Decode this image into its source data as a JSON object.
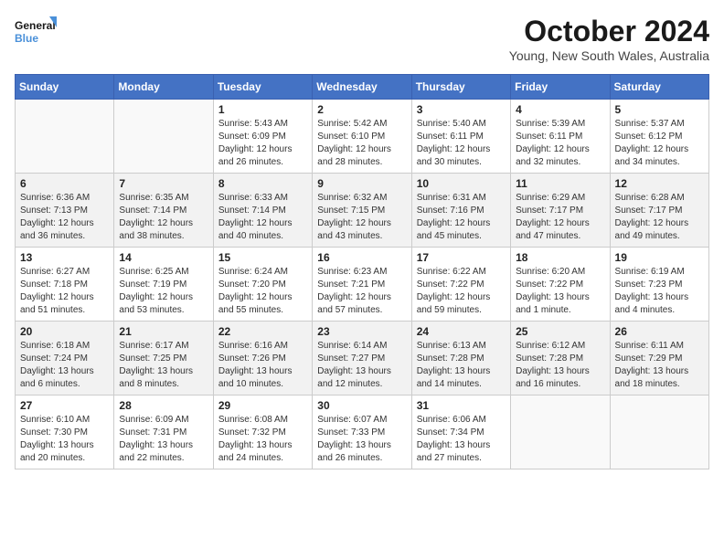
{
  "header": {
    "logo_general": "General",
    "logo_blue": "Blue",
    "month": "October 2024",
    "location": "Young, New South Wales, Australia"
  },
  "days_of_week": [
    "Sunday",
    "Monday",
    "Tuesday",
    "Wednesday",
    "Thursday",
    "Friday",
    "Saturday"
  ],
  "weeks": [
    [
      {
        "day": "",
        "sunrise": "",
        "sunset": "",
        "daylight": ""
      },
      {
        "day": "",
        "sunrise": "",
        "sunset": "",
        "daylight": ""
      },
      {
        "day": "1",
        "sunrise": "Sunrise: 5:43 AM",
        "sunset": "Sunset: 6:09 PM",
        "daylight": "Daylight: 12 hours and 26 minutes."
      },
      {
        "day": "2",
        "sunrise": "Sunrise: 5:42 AM",
        "sunset": "Sunset: 6:10 PM",
        "daylight": "Daylight: 12 hours and 28 minutes."
      },
      {
        "day": "3",
        "sunrise": "Sunrise: 5:40 AM",
        "sunset": "Sunset: 6:11 PM",
        "daylight": "Daylight: 12 hours and 30 minutes."
      },
      {
        "day": "4",
        "sunrise": "Sunrise: 5:39 AM",
        "sunset": "Sunset: 6:11 PM",
        "daylight": "Daylight: 12 hours and 32 minutes."
      },
      {
        "day": "5",
        "sunrise": "Sunrise: 5:37 AM",
        "sunset": "Sunset: 6:12 PM",
        "daylight": "Daylight: 12 hours and 34 minutes."
      }
    ],
    [
      {
        "day": "6",
        "sunrise": "Sunrise: 6:36 AM",
        "sunset": "Sunset: 7:13 PM",
        "daylight": "Daylight: 12 hours and 36 minutes."
      },
      {
        "day": "7",
        "sunrise": "Sunrise: 6:35 AM",
        "sunset": "Sunset: 7:14 PM",
        "daylight": "Daylight: 12 hours and 38 minutes."
      },
      {
        "day": "8",
        "sunrise": "Sunrise: 6:33 AM",
        "sunset": "Sunset: 7:14 PM",
        "daylight": "Daylight: 12 hours and 40 minutes."
      },
      {
        "day": "9",
        "sunrise": "Sunrise: 6:32 AM",
        "sunset": "Sunset: 7:15 PM",
        "daylight": "Daylight: 12 hours and 43 minutes."
      },
      {
        "day": "10",
        "sunrise": "Sunrise: 6:31 AM",
        "sunset": "Sunset: 7:16 PM",
        "daylight": "Daylight: 12 hours and 45 minutes."
      },
      {
        "day": "11",
        "sunrise": "Sunrise: 6:29 AM",
        "sunset": "Sunset: 7:17 PM",
        "daylight": "Daylight: 12 hours and 47 minutes."
      },
      {
        "day": "12",
        "sunrise": "Sunrise: 6:28 AM",
        "sunset": "Sunset: 7:17 PM",
        "daylight": "Daylight: 12 hours and 49 minutes."
      }
    ],
    [
      {
        "day": "13",
        "sunrise": "Sunrise: 6:27 AM",
        "sunset": "Sunset: 7:18 PM",
        "daylight": "Daylight: 12 hours and 51 minutes."
      },
      {
        "day": "14",
        "sunrise": "Sunrise: 6:25 AM",
        "sunset": "Sunset: 7:19 PM",
        "daylight": "Daylight: 12 hours and 53 minutes."
      },
      {
        "day": "15",
        "sunrise": "Sunrise: 6:24 AM",
        "sunset": "Sunset: 7:20 PM",
        "daylight": "Daylight: 12 hours and 55 minutes."
      },
      {
        "day": "16",
        "sunrise": "Sunrise: 6:23 AM",
        "sunset": "Sunset: 7:21 PM",
        "daylight": "Daylight: 12 hours and 57 minutes."
      },
      {
        "day": "17",
        "sunrise": "Sunrise: 6:22 AM",
        "sunset": "Sunset: 7:22 PM",
        "daylight": "Daylight: 12 hours and 59 minutes."
      },
      {
        "day": "18",
        "sunrise": "Sunrise: 6:20 AM",
        "sunset": "Sunset: 7:22 PM",
        "daylight": "Daylight: 13 hours and 1 minute."
      },
      {
        "day": "19",
        "sunrise": "Sunrise: 6:19 AM",
        "sunset": "Sunset: 7:23 PM",
        "daylight": "Daylight: 13 hours and 4 minutes."
      }
    ],
    [
      {
        "day": "20",
        "sunrise": "Sunrise: 6:18 AM",
        "sunset": "Sunset: 7:24 PM",
        "daylight": "Daylight: 13 hours and 6 minutes."
      },
      {
        "day": "21",
        "sunrise": "Sunrise: 6:17 AM",
        "sunset": "Sunset: 7:25 PM",
        "daylight": "Daylight: 13 hours and 8 minutes."
      },
      {
        "day": "22",
        "sunrise": "Sunrise: 6:16 AM",
        "sunset": "Sunset: 7:26 PM",
        "daylight": "Daylight: 13 hours and 10 minutes."
      },
      {
        "day": "23",
        "sunrise": "Sunrise: 6:14 AM",
        "sunset": "Sunset: 7:27 PM",
        "daylight": "Daylight: 13 hours and 12 minutes."
      },
      {
        "day": "24",
        "sunrise": "Sunrise: 6:13 AM",
        "sunset": "Sunset: 7:28 PM",
        "daylight": "Daylight: 13 hours and 14 minutes."
      },
      {
        "day": "25",
        "sunrise": "Sunrise: 6:12 AM",
        "sunset": "Sunset: 7:28 PM",
        "daylight": "Daylight: 13 hours and 16 minutes."
      },
      {
        "day": "26",
        "sunrise": "Sunrise: 6:11 AM",
        "sunset": "Sunset: 7:29 PM",
        "daylight": "Daylight: 13 hours and 18 minutes."
      }
    ],
    [
      {
        "day": "27",
        "sunrise": "Sunrise: 6:10 AM",
        "sunset": "Sunset: 7:30 PM",
        "daylight": "Daylight: 13 hours and 20 minutes."
      },
      {
        "day": "28",
        "sunrise": "Sunrise: 6:09 AM",
        "sunset": "Sunset: 7:31 PM",
        "daylight": "Daylight: 13 hours and 22 minutes."
      },
      {
        "day": "29",
        "sunrise": "Sunrise: 6:08 AM",
        "sunset": "Sunset: 7:32 PM",
        "daylight": "Daylight: 13 hours and 24 minutes."
      },
      {
        "day": "30",
        "sunrise": "Sunrise: 6:07 AM",
        "sunset": "Sunset: 7:33 PM",
        "daylight": "Daylight: 13 hours and 26 minutes."
      },
      {
        "day": "31",
        "sunrise": "Sunrise: 6:06 AM",
        "sunset": "Sunset: 7:34 PM",
        "daylight": "Daylight: 13 hours and 27 minutes."
      },
      {
        "day": "",
        "sunrise": "",
        "sunset": "",
        "daylight": ""
      },
      {
        "day": "",
        "sunrise": "",
        "sunset": "",
        "daylight": ""
      }
    ]
  ]
}
